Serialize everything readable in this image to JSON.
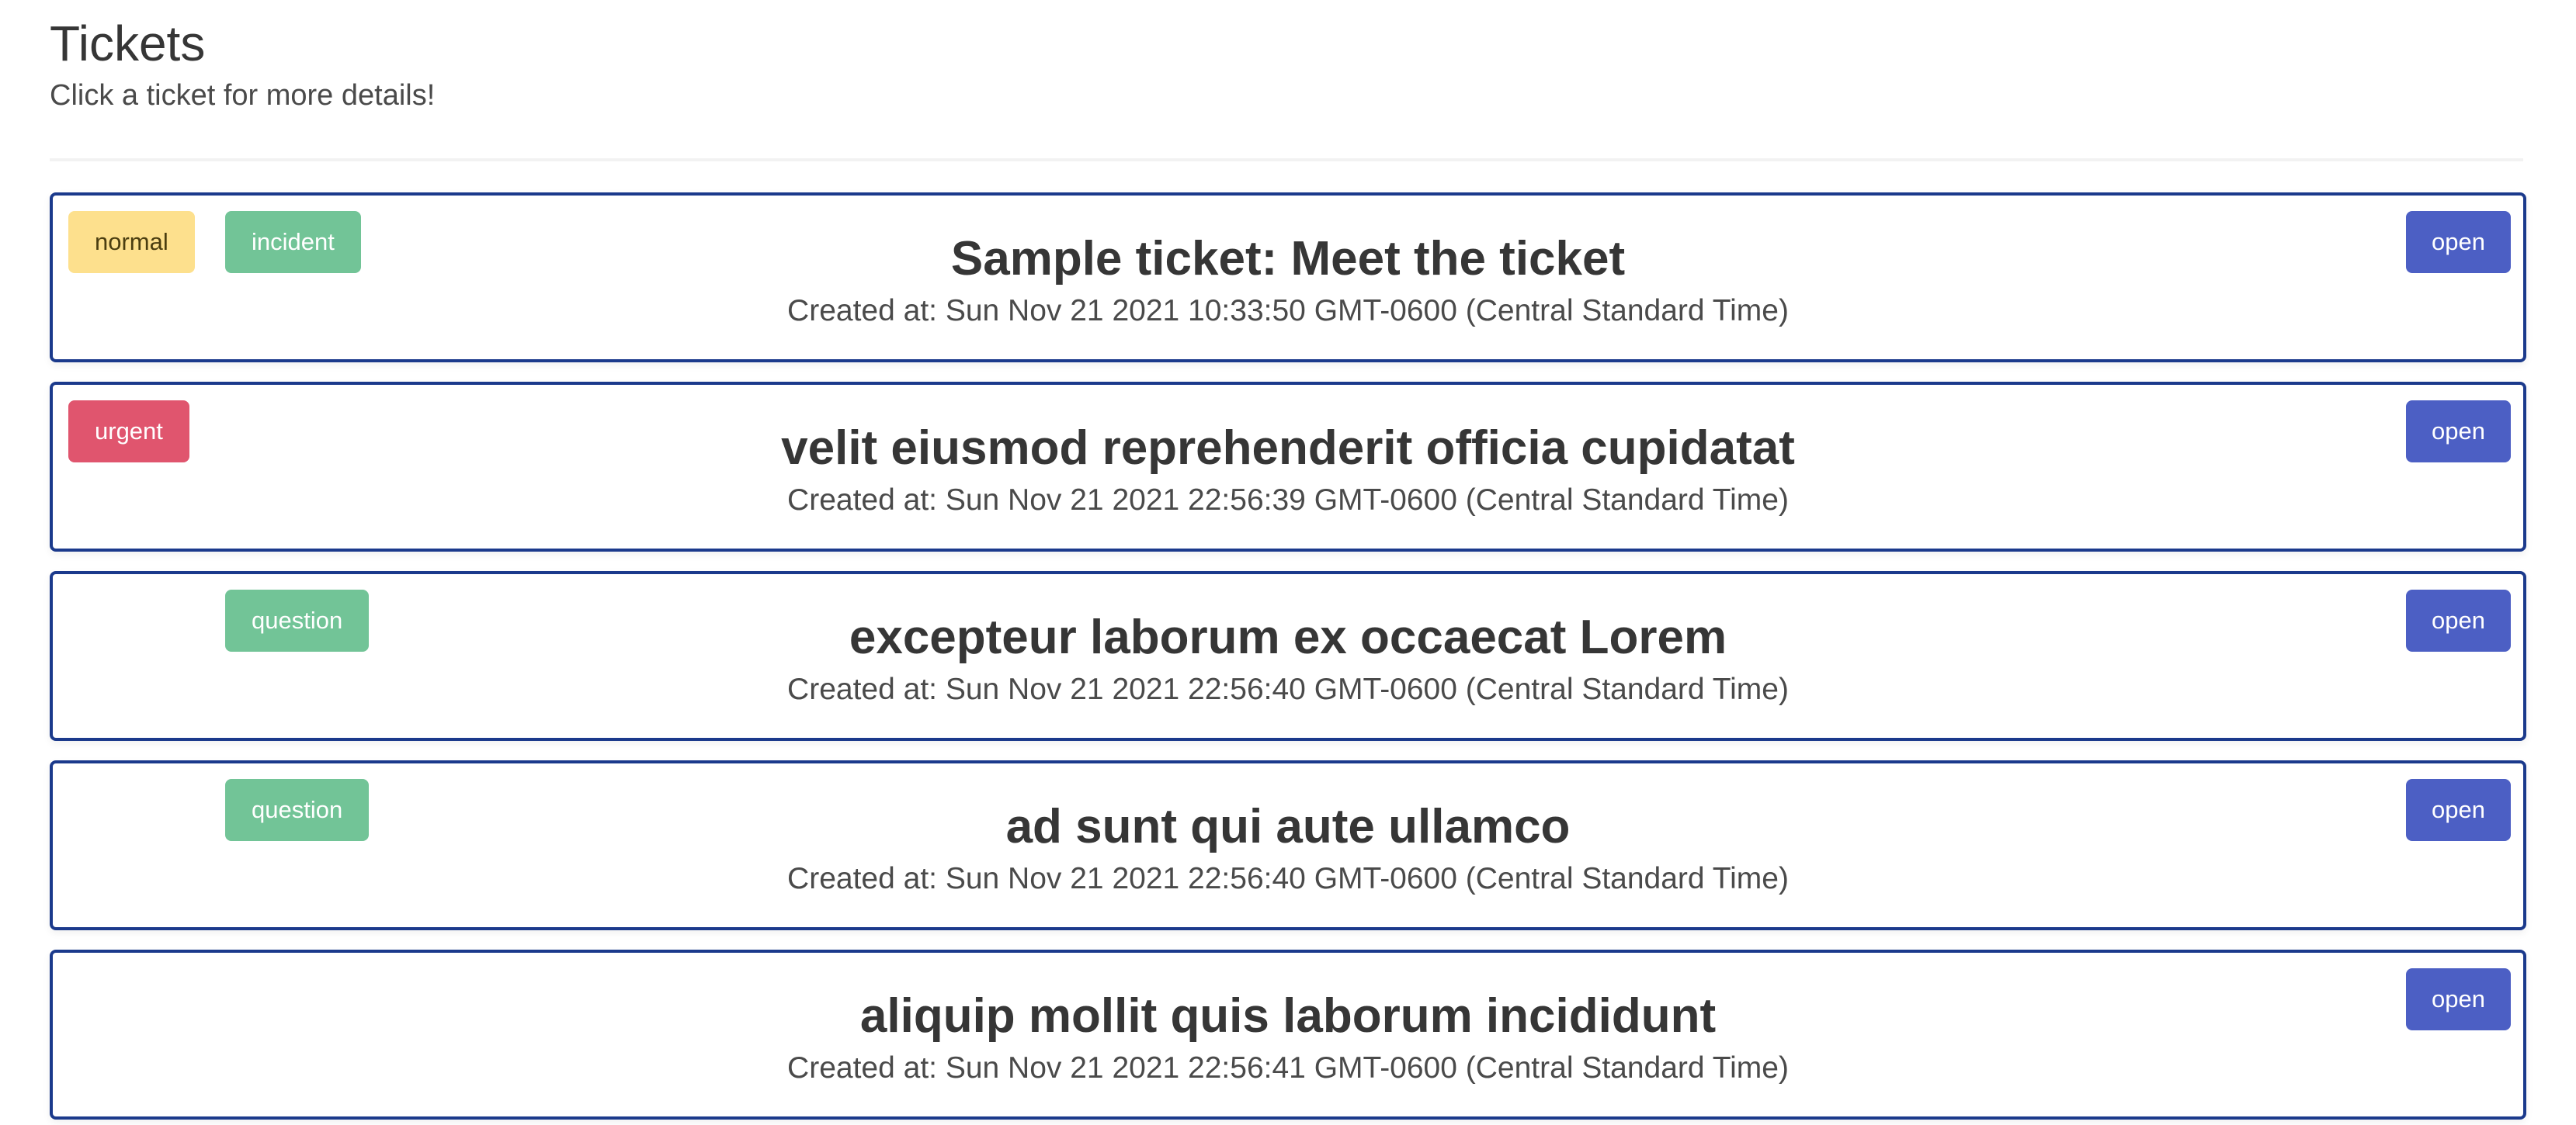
{
  "header": {
    "title": "Tickets",
    "subtitle": "Click a ticket for more details!"
  },
  "colors": {
    "ticket_border": "#1b3a8c",
    "tag_normal": "#fde08d",
    "tag_urgent": "#e0556e",
    "tag_type": "#72c497",
    "status_button": "#4c5fc4"
  },
  "tickets": [
    {
      "priority": "normal",
      "type": "incident",
      "status": "open",
      "title": "Sample ticket: Meet the ticket",
      "created": "Created at: Sun Nov 21 2021 10:33:50 GMT-0600 (Central Standard Time)"
    },
    {
      "priority": "urgent",
      "type": "",
      "status": "open",
      "title": "velit eiusmod reprehenderit officia cupidatat",
      "created": "Created at: Sun Nov 21 2021 22:56:39 GMT-0600 (Central Standard Time)"
    },
    {
      "priority": "",
      "type": "question",
      "status": "open",
      "title": "excepteur laborum ex occaecat Lorem",
      "created": "Created at: Sun Nov 21 2021 22:56:40 GMT-0600 (Central Standard Time)"
    },
    {
      "priority": "",
      "type": "question",
      "status": "open",
      "title": "ad sunt qui aute ullamco",
      "created": "Created at: Sun Nov 21 2021 22:56:40 GMT-0600 (Central Standard Time)"
    },
    {
      "priority": "",
      "type": "",
      "status": "open",
      "title": "aliquip mollit quis laborum incididunt",
      "created": "Created at: Sun Nov 21 2021 22:56:41 GMT-0600 (Central Standard Time)"
    }
  ]
}
